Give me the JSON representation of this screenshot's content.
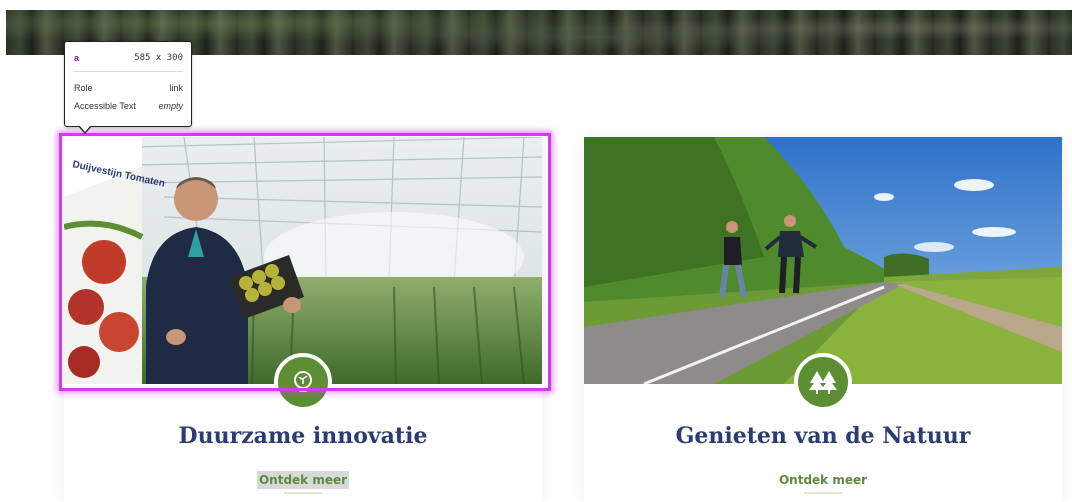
{
  "colors": {
    "title": "#2b3b73",
    "cta": "#5d8a3e",
    "badge": "#5c8e33",
    "highlight": "#d43bf0"
  },
  "tooltip": {
    "tag": "a",
    "dimensions": "585 x 300",
    "role_label": "Role",
    "role_value": "link",
    "accessible_label": "Accessible Text",
    "accessible_value": "empty"
  },
  "cards": [
    {
      "title": "Duurzame innovatie",
      "cta": "Ontdek meer",
      "icon": "seedling-bulb-icon",
      "photo_sign": "Duijvestijn Tomaten"
    },
    {
      "title": "Genieten van de Natuur",
      "cta": "Ontdek meer",
      "icon": "trees-icon"
    }
  ]
}
